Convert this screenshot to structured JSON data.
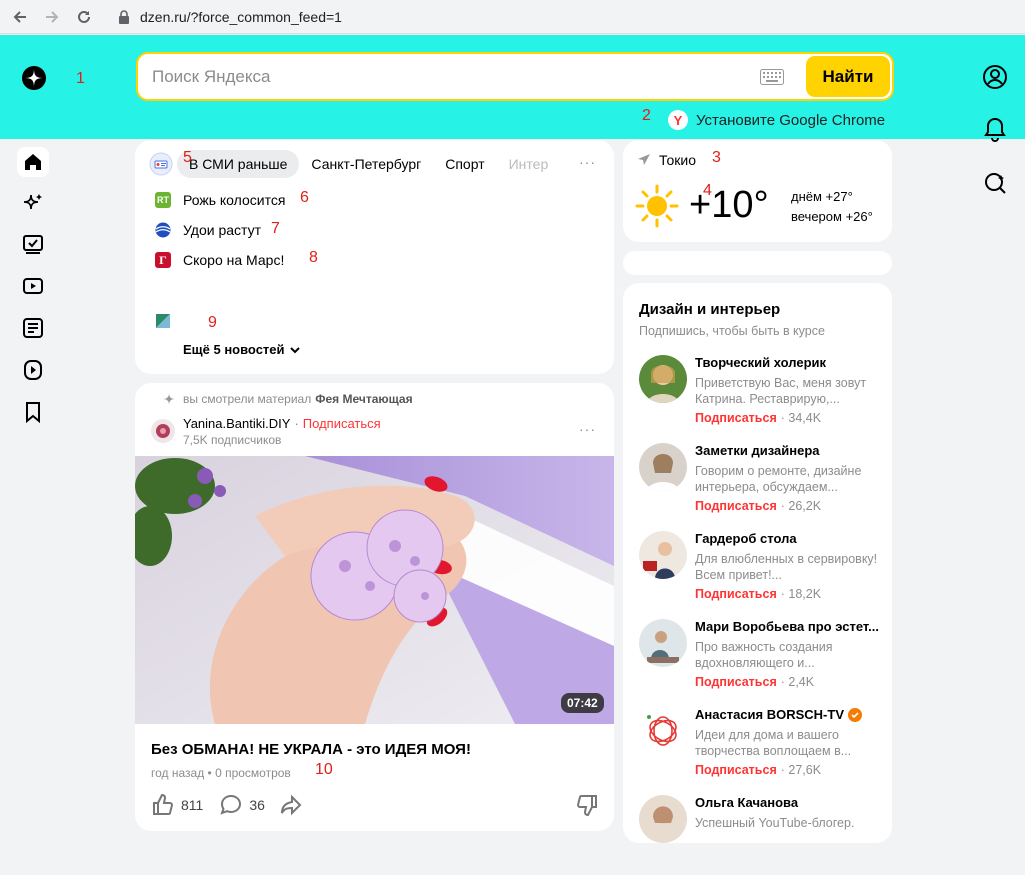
{
  "browser": {
    "url": "dzen.ru/?force_common_feed=1"
  },
  "header": {
    "search_placeholder": "Поиск Яндекса",
    "find_label": "Найти",
    "promo_text": "Установите Google Chrome",
    "accent_color": "#27f2e6",
    "button_color": "#ffd300"
  },
  "annotations": {
    "n1": "1",
    "n2": "2",
    "n3": "3",
    "n4": "4",
    "n5": "5",
    "n6": "6",
    "n7": "7",
    "n8": "8",
    "n9": "9",
    "n10": "10"
  },
  "news": {
    "tabs": [
      {
        "label": "В СМИ раньше"
      },
      {
        "label": "Санкт-Петербург"
      },
      {
        "label": "Спорт"
      },
      {
        "label": "Интер"
      }
    ],
    "more_tabs": "···",
    "items": [
      {
        "title": "Рожь колосится",
        "icon": "rt-icon"
      },
      {
        "title": "Удои растут",
        "icon": "globe-icon"
      },
      {
        "title": "Скоро на Марс!",
        "icon": "g-icon"
      }
    ],
    "more_label": "Ещё 5 новостей"
  },
  "weather": {
    "city": "Токио",
    "temp": "+10°",
    "day": "днём +27°",
    "evening": "вечером +26°"
  },
  "post": {
    "watched_prefix": "вы смотрели материал",
    "watched_title": "Фея Мечтающая",
    "author": "Yanina.Bantiki.DIY",
    "subscribe": "Подписаться",
    "subscribers": "7,5K подписчиков",
    "duration": "07:42",
    "title": "Без ОБМАНА! НЕ УКРАЛА - это ИДЕЯ МОЯ!",
    "meta": "год назад • 0 просмотров",
    "likes": "811",
    "comments": "36"
  },
  "channels": {
    "title": "Дизайн и интерьер",
    "subtitle": "Подпишись, чтобы быть в курсе",
    "items": [
      {
        "name": "Творческий холерик",
        "desc": "Приветствую Вас, меня зовут Катрина. Реставрирую,...",
        "sub": "Подписаться",
        "count": "· 34,4K"
      },
      {
        "name": "Заметки дизайнера",
        "desc": "Говорим о ремонте, дизайне интерьера, обсуждаем...",
        "sub": "Подписаться",
        "count": "· 26,2K"
      },
      {
        "name": "Гардероб стола",
        "desc": "Для влюбленных в сервировку! Всем привет!...",
        "sub": "Подписаться",
        "count": "· 18,2K"
      },
      {
        "name": "Мари Воробьева про эстет...",
        "desc": "Про важность создания вдохновляющего и...",
        "sub": "Подписаться",
        "count": "· 2,4K"
      },
      {
        "name": "Анастасия BORSCH-TV",
        "desc": "Идеи для дома и вашего творчества воплощаем в...",
        "sub": "Подписаться",
        "count": "· 27,6K"
      },
      {
        "name": "Ольга Качанова",
        "desc": "Успешный YouTube-блогер.",
        "sub": "",
        "count": ""
      }
    ]
  }
}
